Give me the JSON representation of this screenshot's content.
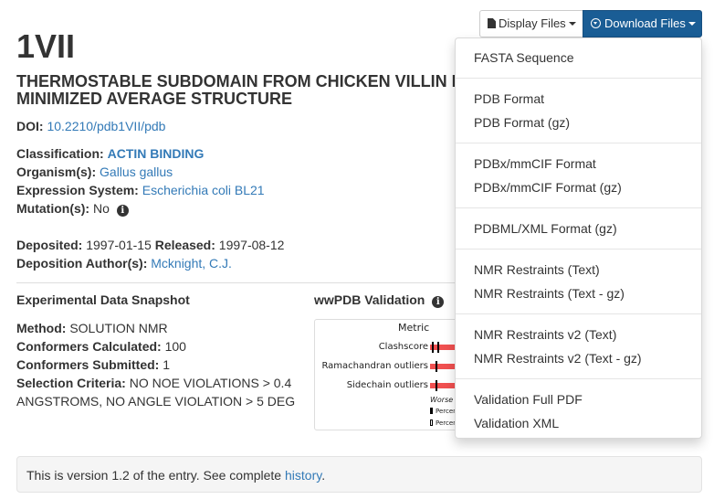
{
  "entry": {
    "pdb_id": "1VII",
    "title": "THERMOSTABLE SUBDOMAIN FROM CHICKEN VILLIN HEADPIECE, NMR, MINIMIZED AVERAGE STRUCTURE",
    "doi_label": "DOI:",
    "doi_value": "10.2210/pdb1VII/pdb",
    "classification_label": "Classification:",
    "classification_value": "ACTIN BINDING",
    "organism_label": "Organism(s):",
    "organism_value": "Gallus gallus",
    "expression_label": "Expression System:",
    "expression_value": "Escherichia coli BL21",
    "mutation_label": "Mutation(s):",
    "mutation_value": "No",
    "deposited_label": "Deposited:",
    "deposited_value": "1997-01-15",
    "released_label": "Released:",
    "released_value": "1997-08-12",
    "authors_label": "Deposition Author(s):",
    "authors_value": "Mcknight, C.J."
  },
  "snapshot": {
    "heading": "Experimental Data Snapshot",
    "method_label": "Method:",
    "method_value": "SOLUTION NMR",
    "conf_calc_label": "Conformers Calculated:",
    "conf_calc_value": "100",
    "conf_sub_label": "Conformers Submitted:",
    "conf_sub_value": "1",
    "criteria_label": "Selection Criteria:",
    "criteria_value": "NO NOE VIOLATIONS > 0.4 ANGSTROMS, NO ANGLE VIOLATION > 5 DEG"
  },
  "validation": {
    "heading": "wwPDB Validation",
    "metric_header": "Metric",
    "metrics": [
      "Clashscore",
      "Ramachandran outliers",
      "Sidechain outliers"
    ],
    "worse_label": "Worse",
    "legend": [
      "Percen",
      "Percen"
    ]
  },
  "toolbar": {
    "display_files": "Display Files",
    "download_files": "Download Files"
  },
  "download_menu": {
    "groups": [
      [
        "FASTA Sequence"
      ],
      [
        "PDB Format",
        "PDB Format (gz)"
      ],
      [
        "PDBx/mmCIF Format",
        "PDBx/mmCIF Format (gz)"
      ],
      [
        "PDBML/XML Format (gz)"
      ],
      [
        "NMR Restraints (Text)",
        "NMR Restraints (Text - gz)"
      ],
      [
        "NMR Restraints v2 (Text)",
        "NMR Restraints v2 (Text - gz)"
      ],
      [
        "Validation Full PDF",
        "Validation XML"
      ]
    ]
  },
  "version": {
    "text": "This is version 1.2 of the entry. See complete ",
    "link": "history",
    "suffix": "."
  },
  "colors": {
    "link": "#337ab7",
    "download_button": "#1a5d95",
    "outlier_bar": "#f05050"
  }
}
